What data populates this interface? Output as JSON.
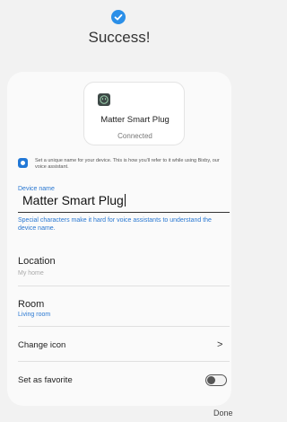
{
  "header": {
    "status_icon": "checkmark-icon",
    "title": "Success!"
  },
  "device": {
    "icon": "smart-plug-icon",
    "name": "Matter Smart Plug",
    "status": "Connected"
  },
  "hint": {
    "icon": "bixby-icon",
    "text": "Set a unique name for your device. This is how you'll refer to it while using Bixby, our voice assistant."
  },
  "name_field": {
    "label": "Device name",
    "value": "Matter Smart Plug",
    "warning": "Special characters make it hard for voice assistants to understand the device name."
  },
  "location": {
    "label": "Location",
    "value": "My home"
  },
  "room": {
    "label": "Room",
    "value": "Living room"
  },
  "change_icon": {
    "label": "Change icon",
    "chevron": ">"
  },
  "favorite": {
    "label": "Set as favorite",
    "enabled": false
  },
  "footer": {
    "done_label": "Done"
  },
  "colors": {
    "accent": "#2b8fe8",
    "link_blue": "#2a78d2",
    "background": "#f2f2f2",
    "card": "#fafafa"
  }
}
